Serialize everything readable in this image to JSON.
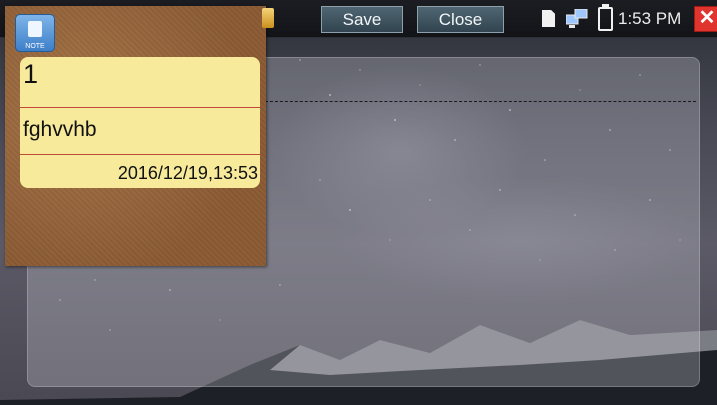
{
  "toolbar": {
    "save_label": "Save",
    "close_label": "Close"
  },
  "status": {
    "time": "1:53 PM",
    "close_glyph": "✕"
  },
  "note_app": {
    "icon_label": "NOTE"
  },
  "note": {
    "title": "1",
    "body": "fghvvhb",
    "timestamp": "2016/12/19,13:53"
  },
  "colors": {
    "note_paper": "#f7ea9a",
    "note_rule": "#c14a3a",
    "cork": "#8b5b34",
    "button": "#3d525e",
    "close_red": "#e0352f"
  },
  "icons": [
    "note-app-icon",
    "pin-icon",
    "sd-card-icon",
    "network-icon",
    "battery-icon",
    "close-icon"
  ]
}
